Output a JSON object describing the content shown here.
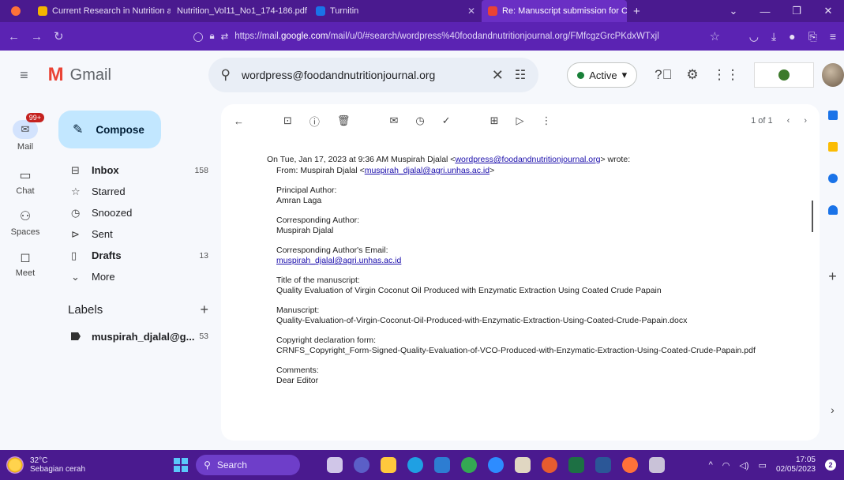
{
  "browser": {
    "tabs": [
      {
        "label": "Current Research in Nutrition a",
        "color": "#f4b400",
        "active": false
      },
      {
        "label": "Nutrition_Vol11_No1_174-186.pdf",
        "color": "#e8e0f5",
        "active": false
      },
      {
        "label": "Turnitin",
        "color": "#1a73e8",
        "active": false
      },
      {
        "label": "Re: Manuscript submission for C",
        "color": "#ea4335",
        "active": true
      }
    ],
    "new_tab": "+",
    "url_prefix": "https://mail.",
    "url_domain": "google.com",
    "url_suffix": "/mail/u/0/#search/wordpress%40foodandnutritionjournal.org/FMfcgzGrcPKdxWTxjl"
  },
  "gmail": {
    "brand": "Gmail",
    "search_value": "wordpress@foodandnutritionjournal.org",
    "status_label": "Active",
    "rail": [
      {
        "label": "Mail",
        "icon": "mail-icon",
        "badge": "99+"
      },
      {
        "label": "Chat",
        "icon": "chat-icon"
      },
      {
        "label": "Spaces",
        "icon": "spaces-icon"
      },
      {
        "label": "Meet",
        "icon": "meet-icon"
      }
    ],
    "compose_label": "Compose",
    "nav": [
      {
        "label": "Inbox",
        "count": "158",
        "bold": true,
        "icon": "inbox-icon"
      },
      {
        "label": "Starred",
        "count": "",
        "bold": false,
        "icon": "star-icon"
      },
      {
        "label": "Snoozed",
        "count": "",
        "bold": false,
        "icon": "clock-icon"
      },
      {
        "label": "Sent",
        "count": "",
        "bold": false,
        "icon": "send-icon"
      },
      {
        "label": "Drafts",
        "count": "13",
        "bold": true,
        "icon": "draft-icon"
      },
      {
        "label": "More",
        "count": "",
        "bold": false,
        "icon": "chevron-down-icon"
      }
    ],
    "labels_heading": "Labels",
    "label_items": [
      {
        "name": "muspirah_djalal@g...",
        "count": "53"
      }
    ],
    "pager": "1 of 1"
  },
  "email": {
    "quote_header_pre": "On Tue, Jan 17, 2023 at 9:36 AM Muspirah Djalal <",
    "quote_header_link": "wordpress@foodandnutritionjournal.org",
    "quote_header_post": "> wrote:",
    "from_pre": "From: Muspirah Djalal <",
    "from_link": "muspirah_djalal@agri.unhas.ac.id",
    "from_post": ">",
    "principal_label": "Principal Author:",
    "principal_value": "Amran Laga",
    "corr_label": "Corresponding Author:",
    "corr_value": "Muspirah Djalal",
    "email_label": "Corresponding Author's Email:",
    "email_value": "muspirah_djalal@agri.unhas.ac.id",
    "title_label": "Title of the manuscript:",
    "title_value": "Quality Evaluation of Virgin Coconut Oil Produced with Enzymatic Extraction Using Coated Crude Papain",
    "manuscript_label": "Manuscript:",
    "manuscript_value": "Quality-Evaluation-of-Virgin-Coconut-Oil-Produced-with-Enzymatic-Extraction-Using-Coated-Crude-Papain.docx",
    "copyright_label": "Copyright declaration form:",
    "copyright_value": "CRNFS_Copyright_Form-Signed-Quality-Evaluation-of-VCO-Produced-with-Enzymatic-Extraction-Using-Coated-Crude-Papain.pdf",
    "comments_label": "Comments:",
    "comments_value": "Dear Editor"
  },
  "taskbar": {
    "temp": "32°C",
    "weather": "Sebagian cerah",
    "search_label": "Search",
    "time": "17:05",
    "date": "02/05/2023",
    "notif_count": "2"
  }
}
